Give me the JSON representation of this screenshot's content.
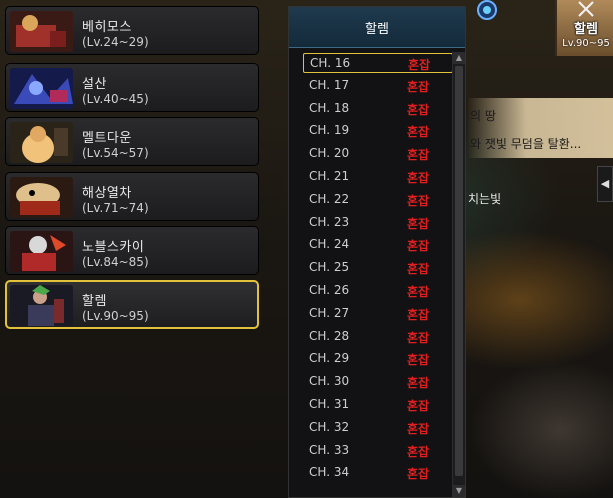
{
  "dungeons": [
    {
      "name": "베히모스",
      "level": "(Lv.24~29)",
      "thumb_icon": "behemoth-icon",
      "thumb_colors": [
        "#7a1e1e",
        "#d9a65a"
      ]
    },
    {
      "name": "설산",
      "level": "(Lv.40~45)",
      "thumb_icon": "snow-mountain-icon",
      "thumb_colors": [
        "#1c2a7a",
        "#6a8ad8"
      ]
    },
    {
      "name": "멜트다운",
      "level": "(Lv.54~57)",
      "thumb_icon": "meltdown-icon",
      "thumb_colors": [
        "#8a5a2a",
        "#f0c27a"
      ]
    },
    {
      "name": "해상열차",
      "level": "(Lv.71~74)",
      "thumb_icon": "sea-train-icon",
      "thumb_colors": [
        "#6a3a1a",
        "#e0c08a"
      ]
    },
    {
      "name": "노블스카이",
      "level": "(Lv.84~85)",
      "thumb_icon": "noble-sky-icon",
      "thumb_colors": [
        "#7a1a1a",
        "#d8d8d8"
      ]
    },
    {
      "name": "할렘",
      "level": "(Lv.90~95)",
      "thumb_icon": "harlem-icon",
      "thumb_colors": [
        "#2a2a3a",
        "#4aa84a"
      ],
      "selected": true
    }
  ],
  "channel_panel": {
    "title": "할렘",
    "channels": [
      {
        "name": "CH. 16",
        "status": "혼잡",
        "selected": true
      },
      {
        "name": "CH. 17",
        "status": "혼잡"
      },
      {
        "name": "CH. 18",
        "status": "혼잡"
      },
      {
        "name": "CH. 19",
        "status": "혼잡"
      },
      {
        "name": "CH. 20",
        "status": "혼잡"
      },
      {
        "name": "CH. 21",
        "status": "혼잡"
      },
      {
        "name": "CH. 22",
        "status": "혼잡"
      },
      {
        "name": "CH. 23",
        "status": "혼잡"
      },
      {
        "name": "CH. 24",
        "status": "혼잡"
      },
      {
        "name": "CH. 25",
        "status": "혼잡"
      },
      {
        "name": "CH. 26",
        "status": "혼잡"
      },
      {
        "name": "CH. 27",
        "status": "혼잡"
      },
      {
        "name": "CH. 28",
        "status": "혼잡"
      },
      {
        "name": "CH. 29",
        "status": "혼잡"
      },
      {
        "name": "CH. 30",
        "status": "혼잡"
      },
      {
        "name": "CH. 31",
        "status": "혼잡"
      },
      {
        "name": "CH. 32",
        "status": "혼잡"
      },
      {
        "name": "CH. 33",
        "status": "혼잡"
      },
      {
        "name": "CH. 34",
        "status": "혼잡"
      }
    ],
    "status_color": "#e02020",
    "selected_border_color": "#e1c23a"
  },
  "map_badge": {
    "name": "할렘",
    "level": "Lv.90~95",
    "icon": "crossed-swords-icon"
  },
  "quest_text": {
    "line1": "의 땅",
    "line2": "와 잿빛 무덤을 탈환...",
    "line3": "치는빛"
  },
  "side_arrow_icon": "arrow-left-icon"
}
